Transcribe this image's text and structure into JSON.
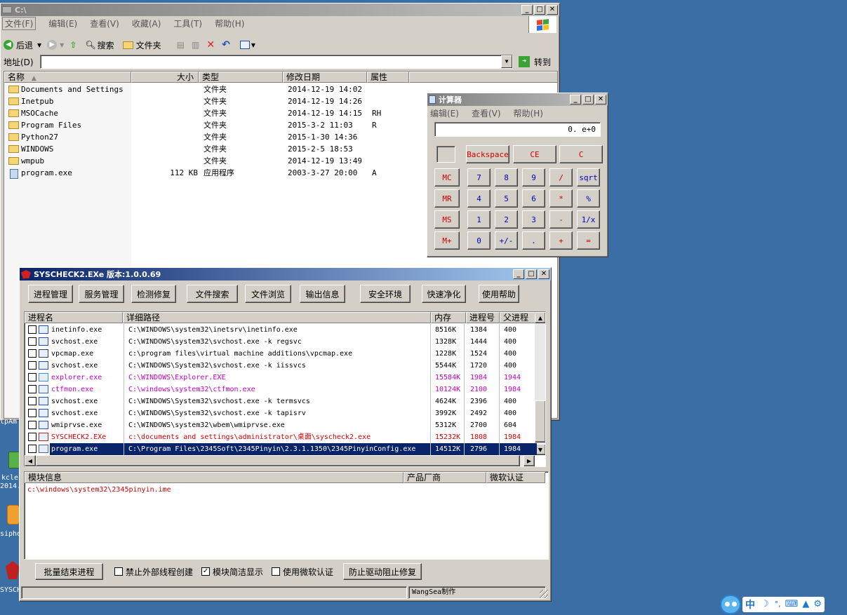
{
  "colors": {
    "desktop": "#3a6ea5",
    "title_active": "#0a246a",
    "selection": "#0a246a",
    "magenta_row": "#c000c0",
    "red_text": "#d00000"
  },
  "explorer": {
    "title": "C:\\",
    "menu": [
      "文件(F)",
      "编辑(E)",
      "查看(V)",
      "收藏(A)",
      "工具(T)",
      "帮助(H)"
    ],
    "toolbar": {
      "back": "后退",
      "search": "搜索",
      "folders": "文件夹"
    },
    "address_label": "地址(D)",
    "address_value": "",
    "go": "转到",
    "columns": [
      "名称",
      "大小",
      "类型",
      "修改日期",
      "属性"
    ],
    "rows": [
      {
        "name": "Documents and Settings",
        "size": "",
        "type": "文件夹",
        "date": "2014-12-19 14:02",
        "attr": "",
        "icon": "folder-icon"
      },
      {
        "name": "Inetpub",
        "size": "",
        "type": "文件夹",
        "date": "2014-12-19 14:26",
        "attr": "",
        "icon": "folder-icon"
      },
      {
        "name": "MSOCache",
        "size": "",
        "type": "文件夹",
        "date": "2014-12-19 14:15",
        "attr": "RH",
        "icon": "folder-icon"
      },
      {
        "name": "Program Files",
        "size": "",
        "type": "文件夹",
        "date": "2015-3-2 11:03",
        "attr": "R",
        "icon": "folder-icon"
      },
      {
        "name": "Python27",
        "size": "",
        "type": "文件夹",
        "date": "2015-1-30 14:36",
        "attr": "",
        "icon": "folder-icon"
      },
      {
        "name": "WINDOWS",
        "size": "",
        "type": "文件夹",
        "date": "2015-2-5 18:53",
        "attr": "",
        "icon": "folder-icon"
      },
      {
        "name": "wmpub",
        "size": "",
        "type": "文件夹",
        "date": "2014-12-19 13:49",
        "attr": "",
        "icon": "folder-icon"
      },
      {
        "name": "program.exe",
        "size": "112 KB",
        "type": "应用程序",
        "date": "2003-3-27 20:00",
        "attr": "A",
        "icon": "exe-icon"
      }
    ]
  },
  "calculator": {
    "title": "计算器",
    "menu": [
      "编辑(E)",
      "查看(V)",
      "帮助(H)"
    ],
    "display": "0. e+0",
    "top_buttons": [
      "Backspace",
      "CE",
      "C"
    ],
    "rows": [
      [
        "MC",
        "7",
        "8",
        "9",
        "/",
        "sqrt"
      ],
      [
        "MR",
        "4",
        "5",
        "6",
        "*",
        "%"
      ],
      [
        "MS",
        "1",
        "2",
        "3",
        "-",
        "1/x"
      ],
      [
        "M+",
        "0",
        "+/-",
        ".",
        "+",
        "="
      ]
    ]
  },
  "syscheck": {
    "title": "SYSCHECK2.EXe  版本:1.0.0.69",
    "tabs": [
      "进程管理",
      "服务管理",
      "检测修复",
      "文件搜索",
      "文件浏览",
      "输出信息",
      "安全环境",
      "快速净化",
      "使用帮助"
    ],
    "columns": [
      "进程名",
      "详细路径",
      "内存",
      "进程号",
      "父进程"
    ],
    "processes": [
      {
        "name": "inetinfo.exe",
        "path": "C:\\WINDOWS\\system32\\inetsrv\\inetinfo.exe",
        "mem": "8516K",
        "pid": "1384",
        "ppid": "400",
        "style": "normal"
      },
      {
        "name": "svchost.exe",
        "path": "C:\\WINDOWS\\system32\\svchost.exe -k regsvc",
        "mem": "1328K",
        "pid": "1444",
        "ppid": "400",
        "style": "normal"
      },
      {
        "name": "vpcmap.exe",
        "path": "c:\\program files\\virtual machine additions\\vpcmap.exe",
        "mem": "1228K",
        "pid": "1524",
        "ppid": "400",
        "style": "normal"
      },
      {
        "name": "svchost.exe",
        "path": "C:\\WINDOWS\\System32\\svchost.exe -k iissvcs",
        "mem": "5544K",
        "pid": "1720",
        "ppid": "400",
        "style": "normal"
      },
      {
        "name": "explorer.exe",
        "path": "C:\\WINDOWS\\Explorer.EXE",
        "mem": "15584K",
        "pid": "1984",
        "ppid": "1944",
        "style": "magenta"
      },
      {
        "name": "ctfmon.exe",
        "path": "C:\\windows\\system32\\ctfmon.exe",
        "mem": "10124K",
        "pid": "2100",
        "ppid": "1984",
        "style": "magenta"
      },
      {
        "name": "svchost.exe",
        "path": "C:\\WINDOWS\\System32\\svchost.exe -k termsvcs",
        "mem": "4624K",
        "pid": "2396",
        "ppid": "400",
        "style": "normal"
      },
      {
        "name": "svchost.exe",
        "path": "C:\\WINDOWS\\System32\\svchost.exe -k tapisrv",
        "mem": "3992K",
        "pid": "2492",
        "ppid": "400",
        "style": "normal"
      },
      {
        "name": "wmiprvse.exe",
        "path": "C:\\WINDOWS\\system32\\wbem\\wmiprvse.exe",
        "mem": "5312K",
        "pid": "2700",
        "ppid": "604",
        "style": "normal"
      },
      {
        "name": "SYSCHECK2.EXe",
        "path": "c:\\documents and settings\\administrator\\桌面\\syscheck2.exe",
        "mem": "15232K",
        "pid": "1808",
        "ppid": "1984",
        "style": "red"
      },
      {
        "name": "program.exe",
        "path": "C:\\Program Files\\2345Soft\\2345Pinyin\\2.3.1.1350\\2345PinyinConfig.exe",
        "mem": "14512K",
        "pid": "2796",
        "ppid": "1984",
        "style": "selected"
      }
    ],
    "module_columns": [
      "模块信息",
      "产品厂商",
      "微软认证"
    ],
    "module_path": "c:\\windows\\system32\\2345pinyin.ime",
    "bottom": {
      "kill_batch": "批量结束进程",
      "opt_block_threads": "禁止外部线程创建",
      "opt_simple_modules": "模块简洁显示",
      "opt_ms_cert": "使用微软认证",
      "prevent_driver": "防止驱动阻止修复"
    },
    "status_credit": "WangSea制作"
  },
  "desktop": {
    "icon_labels": [
      "kcle",
      "2014.4",
      "sipho",
      "SYSCHE"
    ],
    "partial_left": "tpAm"
  },
  "tray": {
    "ime_label": "中"
  }
}
